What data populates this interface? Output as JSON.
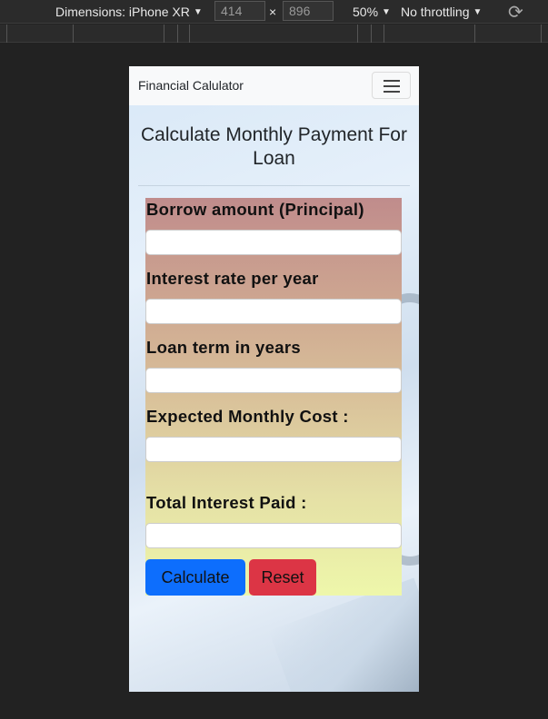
{
  "devtools": {
    "device": "Dimensions: iPhone XR",
    "width": "414",
    "times": "×",
    "height": "896",
    "zoom": "50%",
    "throttling": "No throttling",
    "caret": "▼",
    "rotate_icon": "⟳"
  },
  "navbar": {
    "brand": "Financial Calulator",
    "toggler_icon": "hamburger-icon"
  },
  "page": {
    "heading": "Calculate Monthly Payment For Loan"
  },
  "form": {
    "principal_label": "Borrow amount (Principal)",
    "principal_value": "",
    "rate_label": "Interest rate per year",
    "rate_value": "",
    "term_label": "Loan term in years",
    "term_value": "",
    "monthly_label": "Expected Monthly Cost :",
    "monthly_value": "",
    "interest_label": "Total Interest Paid :",
    "interest_value": "",
    "calculate_button": "Calculate",
    "reset_button": "Reset"
  },
  "colors": {
    "primary": "#0d6efd",
    "danger": "#dc3545"
  }
}
